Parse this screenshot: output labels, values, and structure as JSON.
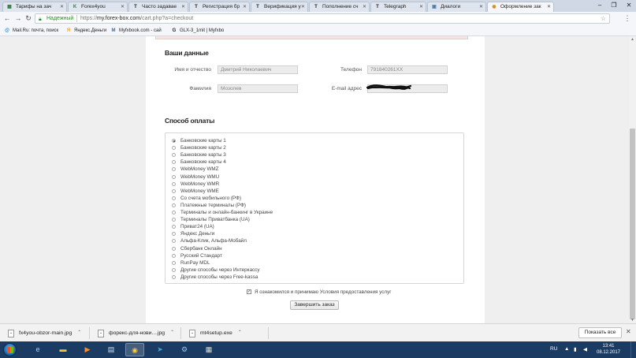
{
  "browser": {
    "tabs": [
      {
        "label": "Тарифы на зач",
        "icon": "spreadsheet-icon",
        "color": "#2a7a36",
        "glyph": "▦"
      },
      {
        "label": "Forex4you",
        "icon": "forex4you-icon",
        "color": "#1d8a3a",
        "glyph": "K"
      },
      {
        "label": "Часто задавае",
        "icon": "telegraph-icon",
        "color": "#222222",
        "glyph": "T"
      },
      {
        "label": "Регистрация бр",
        "icon": "telegraph-icon",
        "color": "#222222",
        "glyph": "T"
      },
      {
        "label": "Верификация у",
        "icon": "telegraph-icon",
        "color": "#222222",
        "glyph": "T"
      },
      {
        "label": "Пополнение сч",
        "icon": "telegraph-icon",
        "color": "#222222",
        "glyph": "T"
      },
      {
        "label": "Telegraph",
        "icon": "telegraph-icon",
        "color": "#222222",
        "glyph": "T"
      },
      {
        "label": "Диалоги",
        "icon": "vk-icon",
        "color": "#4a76a8",
        "glyph": "▣"
      },
      {
        "label": "Оформление зак",
        "icon": "page-icon",
        "color": "#d08a1a",
        "glyph": "◉"
      }
    ],
    "secure_label": "Надежный",
    "url_scheme": "https://",
    "url_host": "my.forex-box.com",
    "url_path": "/cart.php?a=checkout",
    "bookmarks": [
      {
        "label": "Mail.Ru: почта, поиск",
        "icon": "mailru-icon",
        "color": "#168de2",
        "glyph": "@"
      },
      {
        "label": "Яндекс.Деньги",
        "icon": "yandex-money-icon",
        "color": "#f5a623",
        "glyph": "Я"
      },
      {
        "label": "Myfxbook.com - сай",
        "icon": "myfxbook-icon",
        "color": "#3a6ea5",
        "glyph": "M"
      },
      {
        "label": "GLX-3_1mit | Myfxbo",
        "icon": "myfxbook-icon",
        "color": "#222222",
        "glyph": "G"
      }
    ]
  },
  "checkout": {
    "your_data_title": "Ваши данные",
    "fields": {
      "name_label": "Имя и отчество",
      "name_value": "Дмитрий Николаевич",
      "surname_label": "Фамилия",
      "surname_value": "Мозолев",
      "phone_label": "Телефон",
      "phone_value": "791840261XX",
      "email_label": "E-mail адрес",
      "email_value": ""
    },
    "payment_title": "Способ оплаты",
    "payment_methods": [
      "Банковские карты 1",
      "Банковские карты 2",
      "Банковские карты 3",
      "Банковские карты 4",
      "WebMoney WMZ",
      "WebMoney WMU",
      "WebMoney WMR",
      "WebMoney WME",
      "Со счета мобильного (РФ)",
      "Платежные терминалы (РФ)",
      "Терминалы и онлайн-банкинг в Украине",
      "Терминалы Приватбанка (UA)",
      "Приват24 (UA)",
      "Яндекс Деньги",
      "Альфа-Клик, Альфа-Мобайл",
      "Сбербанк Онлайн",
      "Русский Стандарт",
      "RunPay MDL",
      "Другие способы через Интеркассу",
      "Другие способы через Free-kassa"
    ],
    "selected_index": 0,
    "agree_label": "Я ознакомился и принимаю Условия предоставления услуг",
    "agree_checked": "✓",
    "submit_label": "Завершить заказ"
  },
  "downloads": {
    "items": [
      {
        "label": "fx4you-obzor-main.jpg"
      },
      {
        "label": "форекс-для-нови....jpg"
      },
      {
        "label": "mt4setup.exe"
      }
    ],
    "show_all_label": "Показать все"
  },
  "taskbar": {
    "language": "RU",
    "time": "13:41",
    "date": "08.12.2017"
  }
}
